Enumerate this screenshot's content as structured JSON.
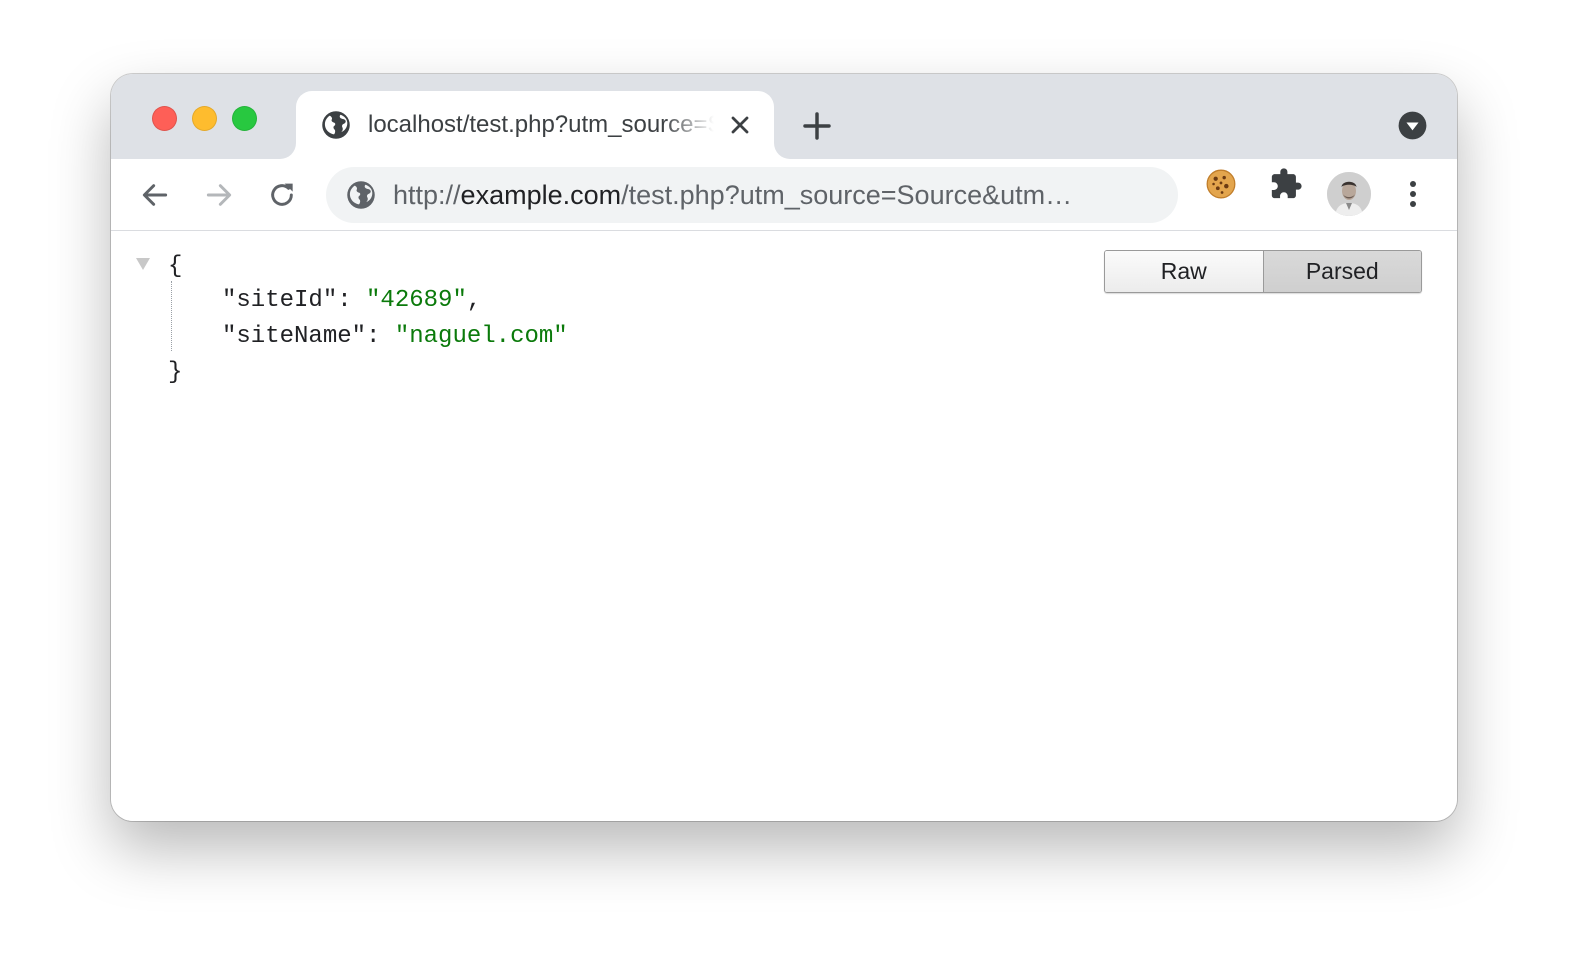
{
  "tab": {
    "title": "localhost/test.php?utm_source=Source&utm_medium=Medium",
    "icon": "globe-icon",
    "close_icon": "close-icon"
  },
  "toolbar": {
    "url_scheme": "http://",
    "url_host": "example.com",
    "url_rest": "/test.php?utm_source=Source&utm…",
    "back_icon": "arrow-left-icon",
    "forward_icon": "arrow-right-icon",
    "reload_icon": "reload-icon",
    "extensions": [
      "cookie-icon",
      "puzzle-icon"
    ],
    "menu_icon": "kebab-menu-icon"
  },
  "json_view": {
    "open_brace": "{",
    "close_brace": "}",
    "entries": [
      {
        "key": "\"siteId\"",
        "sep": ": ",
        "value": "\"42689\"",
        "trail": ","
      },
      {
        "key": "\"siteName\"",
        "sep": ": ",
        "value": "\"naguel.com\"",
        "trail": ""
      }
    ],
    "mode_buttons": {
      "raw": "Raw",
      "parsed": "Parsed"
    },
    "active_mode": "Parsed"
  },
  "colors": {
    "titlebar": "#dee1e6",
    "omnibox": "#f1f3f4",
    "json_string": "#0b7a0b",
    "close_red": "#fe5f57",
    "minimize_yellow": "#febc2e",
    "zoom_green": "#28c840"
  }
}
